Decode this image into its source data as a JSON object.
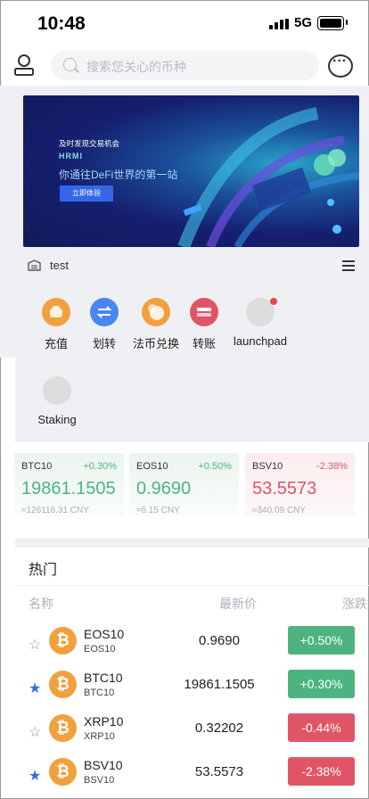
{
  "status_bar": {
    "time": "10:48",
    "network": "5G"
  },
  "search": {
    "placeholder": "搜索您关心的币种"
  },
  "banner": {
    "line1": "及时发现交易机会",
    "line2": "HRMI",
    "line3": "你通往DeFi世界的第一站",
    "button_label": "立即体验"
  },
  "announcement": {
    "text": "test"
  },
  "quick_actions": [
    {
      "label": "充值",
      "icon": "deposit-icon",
      "color": "#f2a03d"
    },
    {
      "label": "划转",
      "icon": "transfer-icon",
      "color": "#4a86f0"
    },
    {
      "label": "法币兑换",
      "icon": "fiat-exchange-icon",
      "color": "#f2a03d"
    },
    {
      "label": "转账",
      "icon": "send-icon",
      "color": "#e05566"
    },
    {
      "label": "launchpad",
      "icon": "launchpad-icon",
      "color": "#dddddd"
    },
    {
      "label": "Staking",
      "icon": "staking-icon",
      "color": "#dddddd"
    }
  ],
  "ticker_cards": [
    {
      "symbol": "BTC10",
      "change": "+0.30%",
      "price": "19861.1505",
      "cny": "≈126118.31 CNY",
      "trend": "up"
    },
    {
      "symbol": "EOS10",
      "change": "+0.50%",
      "price": "0.9690",
      "cny": "≈6.15 CNY",
      "trend": "up"
    },
    {
      "symbol": "BSV10",
      "change": "-2.38%",
      "price": "53.5573",
      "cny": "≈340.09 CNY",
      "trend": "down"
    }
  ],
  "hot": {
    "title": "热门",
    "columns": {
      "name": "名称",
      "price": "最新价",
      "change": "涨跌"
    },
    "rows": [
      {
        "name": "EOS10",
        "sub": "EOS10",
        "price": "0.9690",
        "change": "+0.50%",
        "trend": "up",
        "starred": false
      },
      {
        "name": "BTC10",
        "sub": "BTC10",
        "price": "19861.1505",
        "change": "+0.30%",
        "trend": "up",
        "starred": true
      },
      {
        "name": "XRP10",
        "sub": "XRP10",
        "price": "0.32202",
        "change": "-0.44%",
        "trend": "down",
        "starred": false
      },
      {
        "name": "BSV10",
        "sub": "BSV10",
        "price": "53.5573",
        "change": "-2.38%",
        "trend": "down",
        "starred": true
      }
    ]
  },
  "colors": {
    "up": "#4db47f",
    "down": "#e05566",
    "star": "#3a6fe0",
    "coin": "#f2a03d"
  }
}
